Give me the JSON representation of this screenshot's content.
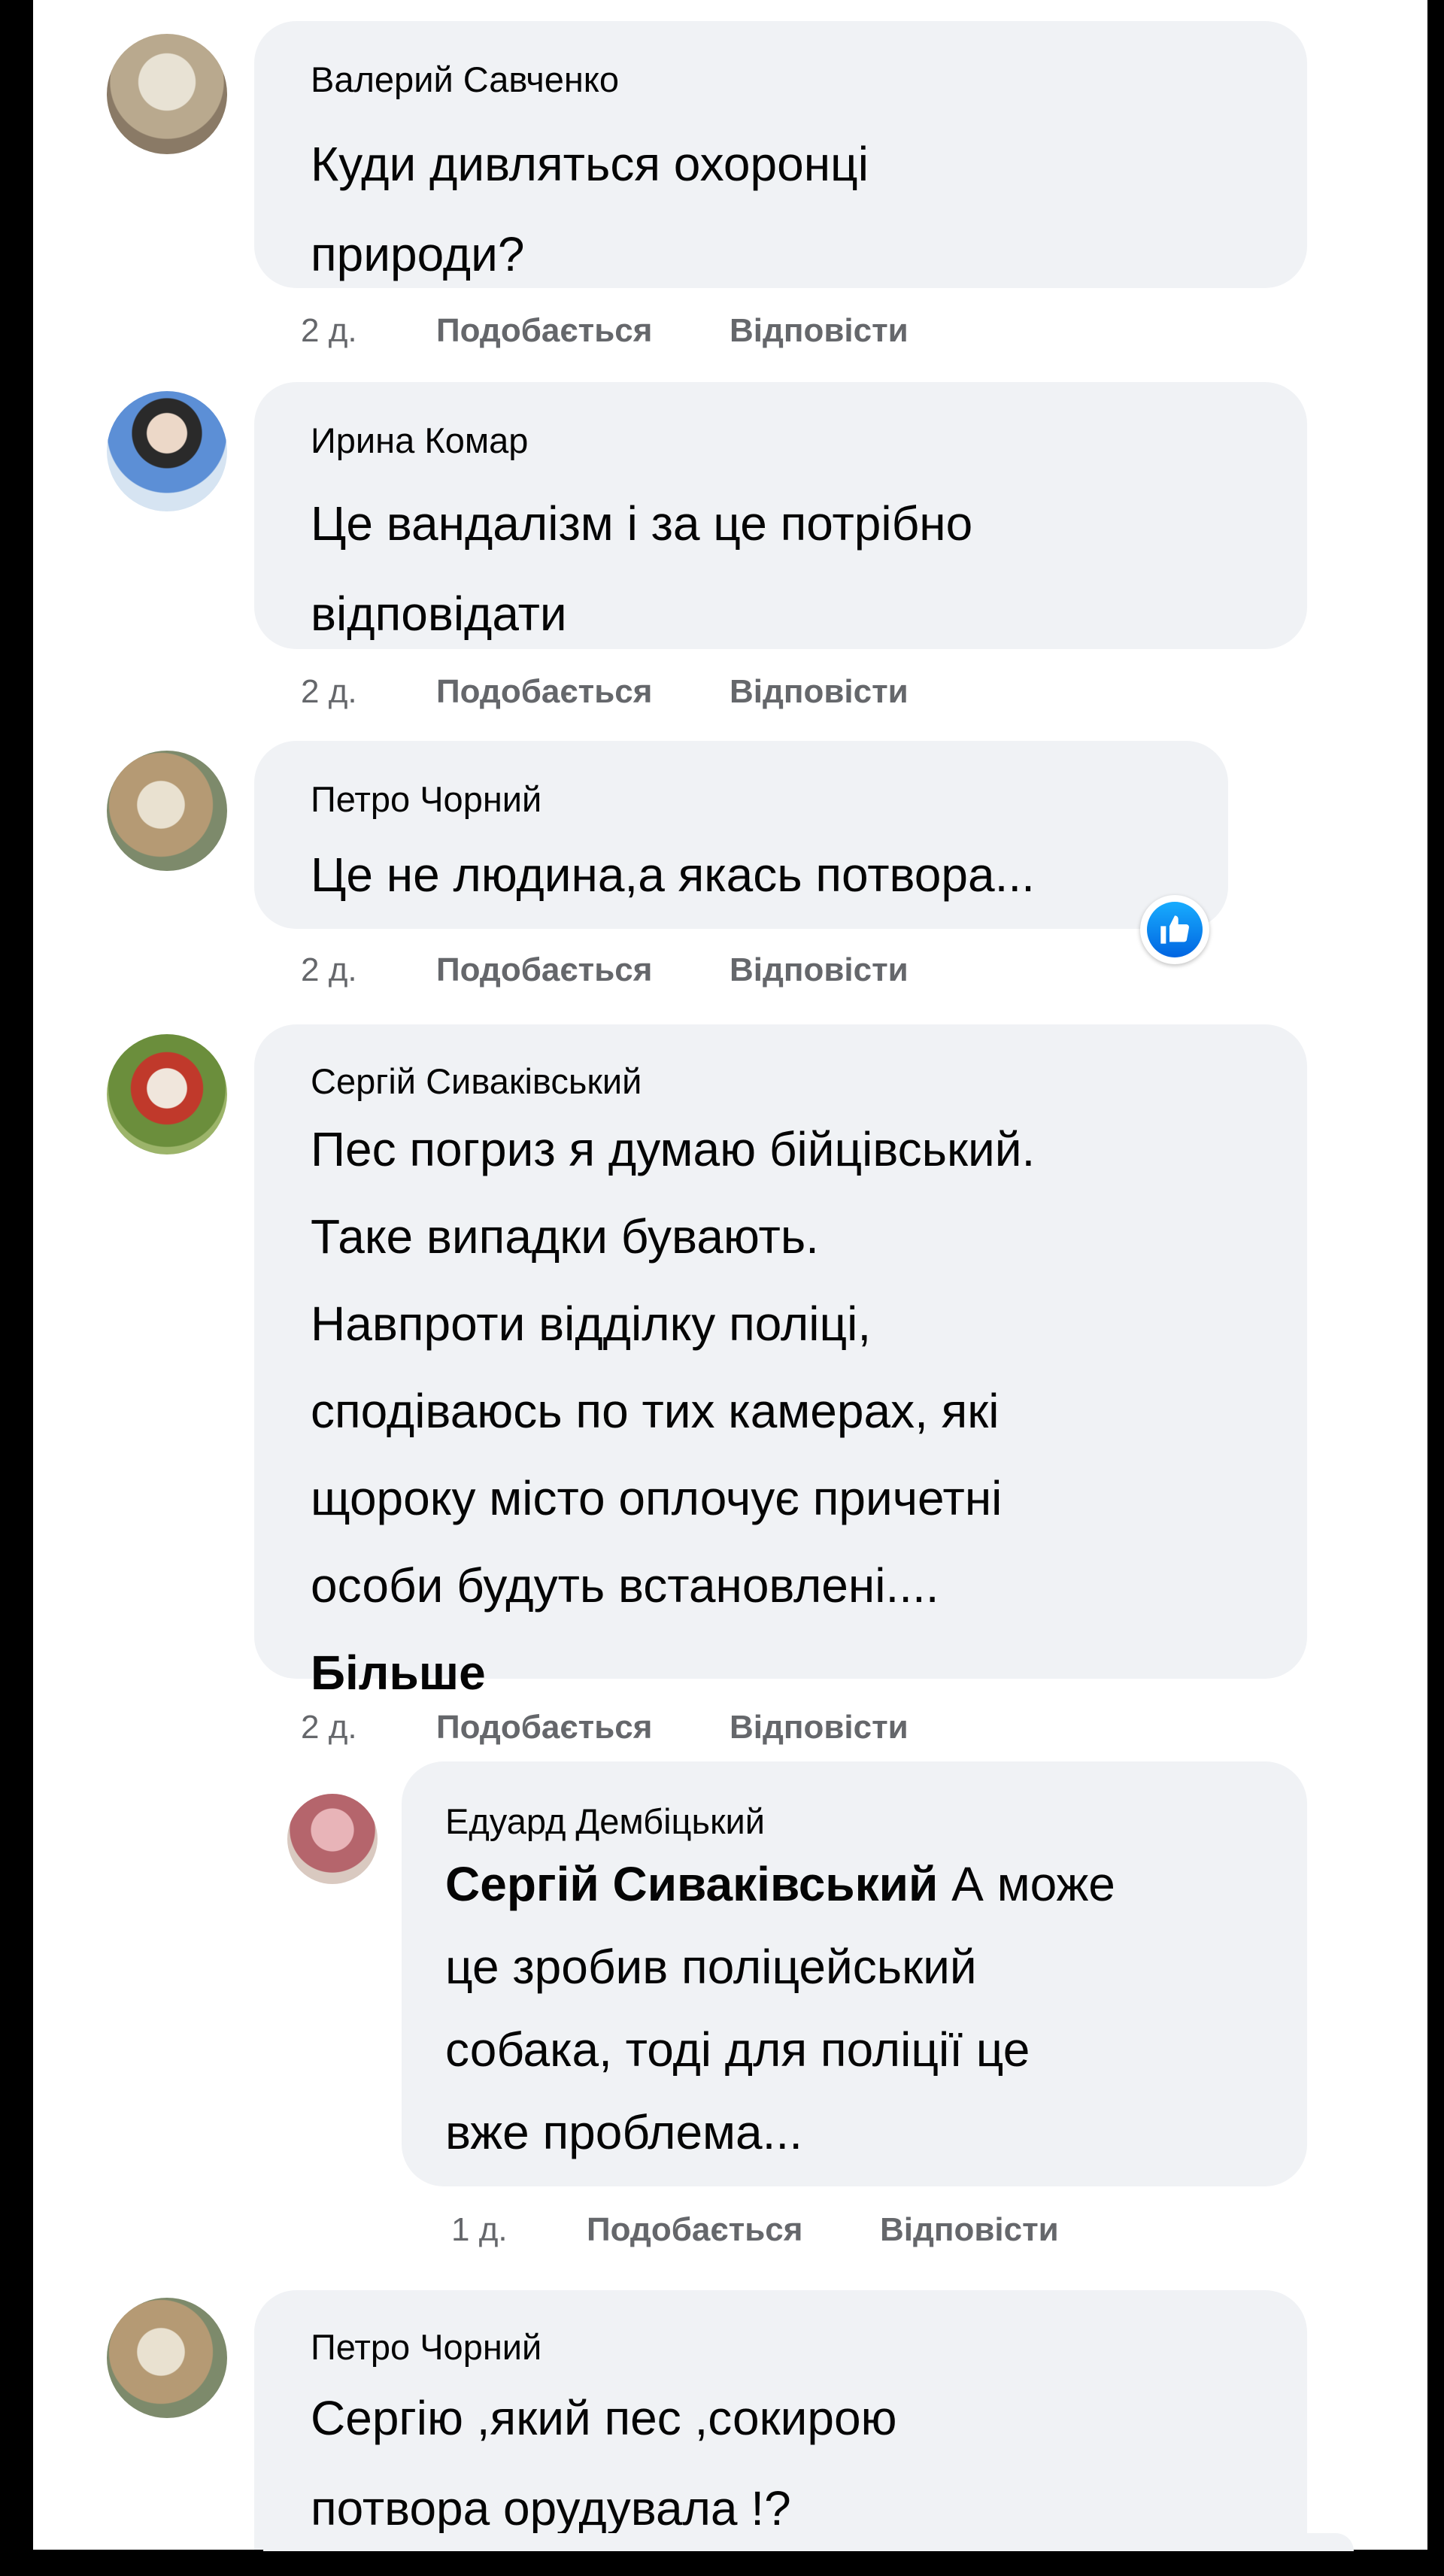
{
  "comments": [
    {
      "author": "Валерий Савченко",
      "lines": [
        "Куди дивляться охоронці",
        "природи?"
      ],
      "time": "2 д.",
      "like": "Подобається",
      "reply": "Відповісти"
    },
    {
      "author": "Ирина Комар",
      "lines": [
        "Це вандалізм і за це потрібно",
        "відповідати"
      ],
      "time": "2 д.",
      "like": "Подобається",
      "reply": "Відповісти"
    },
    {
      "author": "Петро Чорний",
      "lines": [
        "Це не людина,а якась потвора..."
      ],
      "time": "2 д.",
      "like": "Подобається",
      "reply": "Відповісти",
      "reaction_icon": "thumbs-up-icon"
    },
    {
      "author": "Сергій Сиваківський",
      "lines": [
        "Пес погриз я думаю бійцівський.",
        "Таке випадки бувають.",
        "Навпроти відділку поліці,",
        "сподіваюсь по тих камерах, які",
        "щороку місто оплочує причетні",
        "особи будуть встановлені...."
      ],
      "more": "Більше",
      "time": "2 д.",
      "like": "Подобається",
      "reply": "Відповісти"
    },
    {
      "author": "Едуард Дембіцький",
      "mention": "Сергій Сиваківський",
      "first_line_rest": " А може",
      "lines": [
        "це зробив поліцейський",
        "собака, тоді для поліції це",
        "вже проблема..."
      ],
      "time": "1 д.",
      "like": "Подобається",
      "reply": "Відповісти"
    },
    {
      "author": "Петро Чорний",
      "lines": [
        "Сергію ,який пес ,сокирою",
        "потвора орудувала !?"
      ]
    }
  ],
  "colors": {
    "bubble": "#f0f2f5",
    "meta_text": "#65676b",
    "like_reaction": "#1877f2"
  }
}
